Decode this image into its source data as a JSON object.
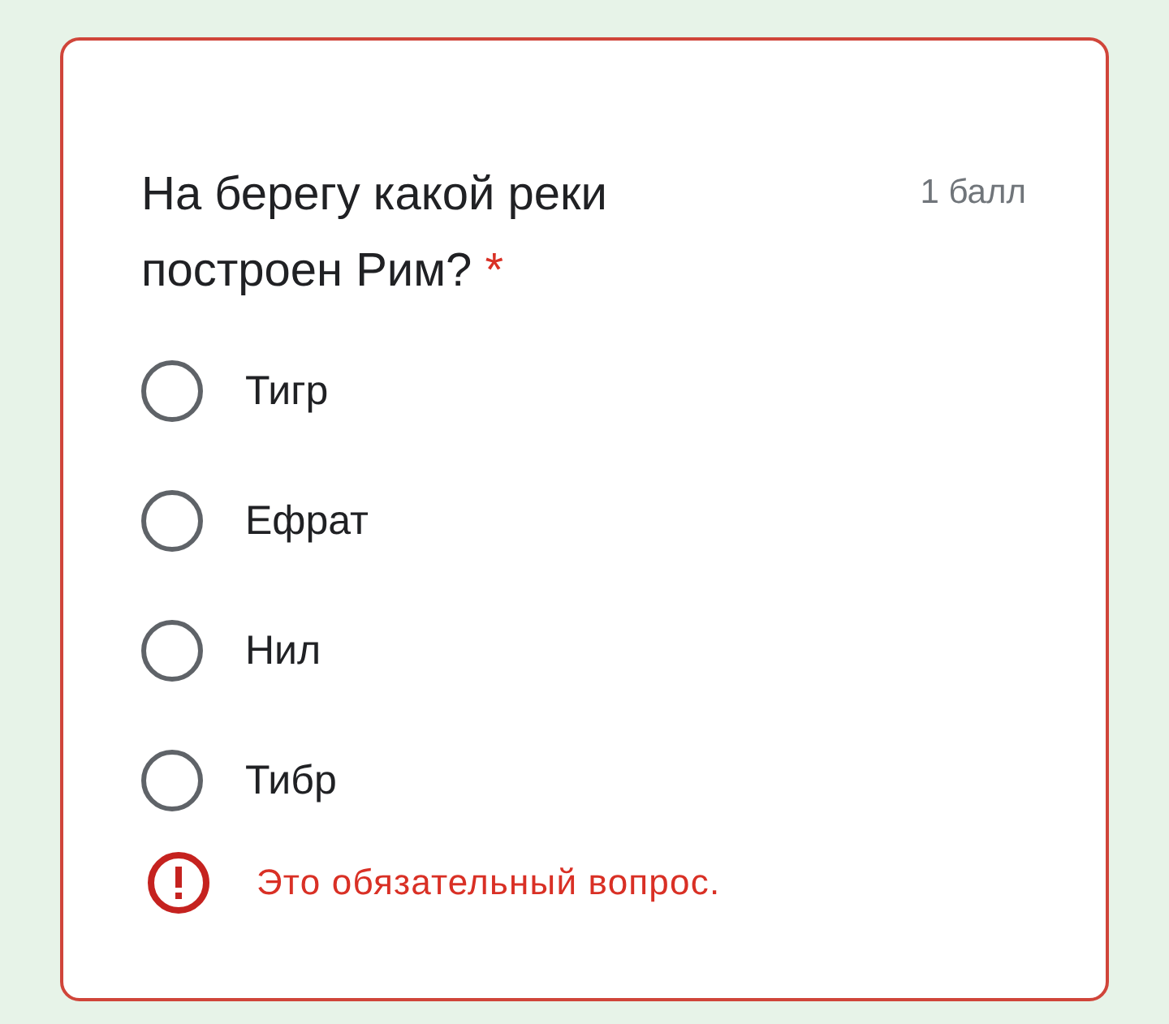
{
  "question": {
    "title": "На берегу какой реки построен Рим?",
    "required_mark": "*",
    "points": "1 балл",
    "has_error": true
  },
  "options": [
    {
      "label": "Тигр",
      "selected": false
    },
    {
      "label": "Ефрат",
      "selected": false
    },
    {
      "label": "Нил",
      "selected": false
    },
    {
      "label": "Тибр",
      "selected": false
    }
  ],
  "error": {
    "text": "Это обязательный вопрос."
  }
}
